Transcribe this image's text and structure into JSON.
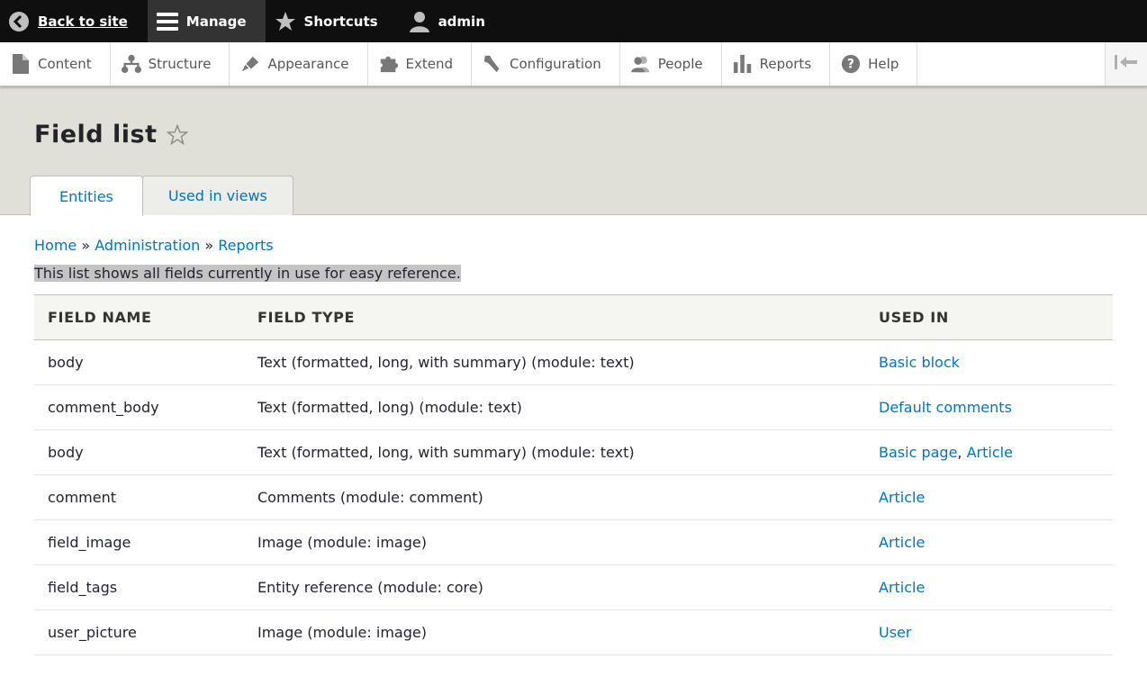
{
  "toolbar": {
    "back_label": "Back to site",
    "manage_label": "Manage",
    "shortcuts_label": "Shortcuts",
    "user_label": "admin"
  },
  "tray": {
    "items": [
      {
        "label": "Content",
        "icon": "file-icon"
      },
      {
        "label": "Structure",
        "icon": "sitemap-icon"
      },
      {
        "label": "Appearance",
        "icon": "paintbrush-icon"
      },
      {
        "label": "Extend",
        "icon": "puzzle-icon"
      },
      {
        "label": "Configuration",
        "icon": "wrench-icon"
      },
      {
        "label": "People",
        "icon": "people-icon"
      },
      {
        "label": "Reports",
        "icon": "bar-chart-icon"
      },
      {
        "label": "Help",
        "icon": "question-icon"
      }
    ]
  },
  "page": {
    "title": "Field list",
    "tabs": [
      {
        "label": "Entities",
        "active": true
      },
      {
        "label": "Used in views",
        "active": false
      }
    ]
  },
  "breadcrumb": {
    "items": [
      "Home",
      "Administration",
      "Reports"
    ],
    "separator": "»"
  },
  "intro_text": "This list shows all fields currently in use for easy reference.",
  "table": {
    "headers": [
      "FIELD NAME",
      "FIELD TYPE",
      "USED IN"
    ],
    "rows": [
      {
        "name": "body",
        "type": "Text (formatted, long, with summary) (module: text)",
        "used_in": [
          "Basic block"
        ]
      },
      {
        "name": "comment_body",
        "type": "Text (formatted, long) (module: text)",
        "used_in": [
          "Default comments"
        ]
      },
      {
        "name": "body",
        "type": "Text (formatted, long, with summary) (module: text)",
        "used_in": [
          "Basic page",
          "Article"
        ]
      },
      {
        "name": "comment",
        "type": "Comments (module: comment)",
        "used_in": [
          "Article"
        ]
      },
      {
        "name": "field_image",
        "type": "Image (module: image)",
        "used_in": [
          "Article"
        ]
      },
      {
        "name": "field_tags",
        "type": "Entity reference (module: core)",
        "used_in": [
          "Article"
        ]
      },
      {
        "name": "user_picture",
        "type": "Image (module: image)",
        "used_in": [
          "User"
        ]
      }
    ]
  },
  "colors": {
    "link": "#0074bd",
    "topbar": "#0f0f0f",
    "header_bg": "#e0e0d8"
  }
}
